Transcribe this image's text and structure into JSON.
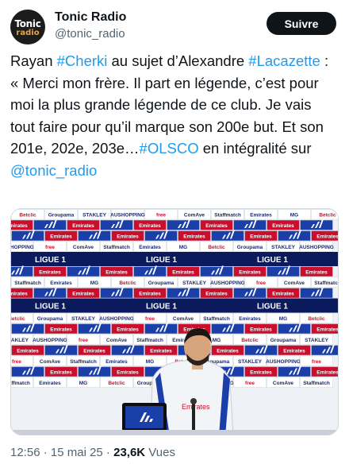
{
  "account": {
    "display_name": "Tonic Radio",
    "handle": "@tonic_radio",
    "avatar_top": "Tonic",
    "avatar_bottom": "radio"
  },
  "follow_label": "Suivre",
  "tweet": {
    "t1": "Rayan ",
    "h1": "#Cherki",
    "t2": " au sujet d’Alexandre ",
    "h2": "#Lacazette",
    "t3": " : « Merci mon frère. Il part en légende, c’est pour moi la plus grande légende de ce club. Je vais tout faire pour qu’il marque son 200e but. Et son 201e, 202e, 203e…",
    "h3": "#OLSCO",
    "t4": " en intégralité sur ",
    "m1": "@tonic_radio"
  },
  "meta": {
    "time": "12:56",
    "sep1": " · ",
    "date": "15 mai 25",
    "sep2": " · ",
    "views_count": "23,6K",
    "views_label": " Vues"
  },
  "photo": {
    "banner_text": "LIGUE 1",
    "sponsors": [
      "Betclic",
      "Groupama",
      "STAKLEY",
      "AUSHOPPING",
      "free",
      "ComAve",
      "Staffmatch",
      "Emirates",
      "MG"
    ],
    "shirt_text": "Emirates",
    "colors": {
      "board": "#ffffff",
      "adidas_blue": "#1b3fa8",
      "emirates_red": "#c8102e",
      "ligue_bar": "#0a1a5c"
    }
  }
}
